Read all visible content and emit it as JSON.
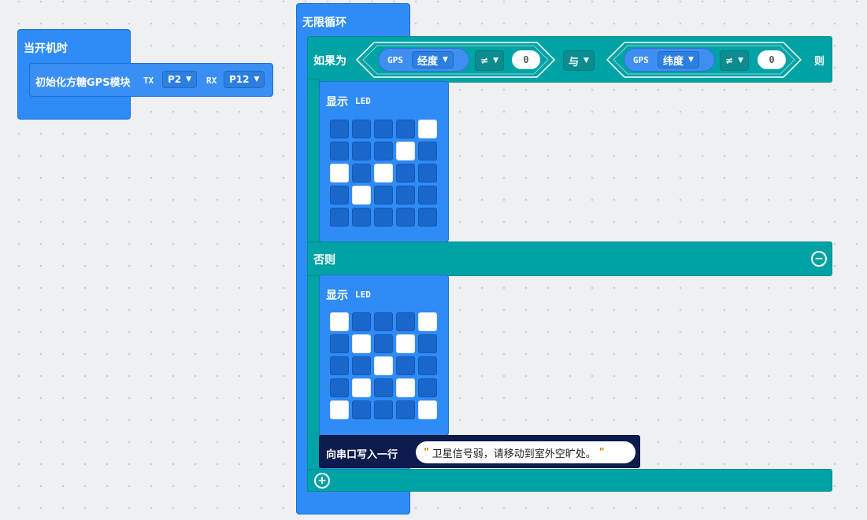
{
  "on_start": {
    "title": "当开机时",
    "init_label": "初始化方糖GPS模块",
    "tx_label": "TX",
    "tx_value": "P2",
    "rx_label": "RX",
    "rx_value": "P12"
  },
  "forever": {
    "title": "无限循环"
  },
  "if_block": {
    "if_label": "如果为",
    "then_label": "则",
    "else_label": "否则",
    "and_label": "与",
    "left_cond": {
      "source": "GPS",
      "field": "经度",
      "operator": "≠",
      "value": "0"
    },
    "right_cond": {
      "source": "GPS",
      "field": "纬度",
      "operator": "≠",
      "value": "0"
    },
    "remove_icon": "minus-circle-icon",
    "add_icon": "plus-circle-icon"
  },
  "show_led_1": {
    "label": "显示",
    "sublabel": "LED",
    "pattern": [
      [
        0,
        0,
        0,
        0,
        1
      ],
      [
        0,
        0,
        0,
        1,
        0
      ],
      [
        1,
        0,
        1,
        0,
        0
      ],
      [
        0,
        1,
        0,
        0,
        0
      ],
      [
        0,
        0,
        0,
        0,
        0
      ]
    ]
  },
  "show_led_2": {
    "label": "显示",
    "sublabel": "LED",
    "pattern": [
      [
        1,
        0,
        0,
        0,
        1
      ],
      [
        0,
        1,
        0,
        1,
        0
      ],
      [
        0,
        0,
        1,
        0,
        0
      ],
      [
        0,
        1,
        0,
        1,
        0
      ],
      [
        1,
        0,
        0,
        0,
        1
      ]
    ]
  },
  "serial": {
    "label": "向串口写入一行",
    "value": "卫星信号弱，请移动到室外空旷处。"
  },
  "colors": {
    "blue": "#2f8cf7",
    "teal": "#00a3a5",
    "navy": "#0d1b4d"
  }
}
